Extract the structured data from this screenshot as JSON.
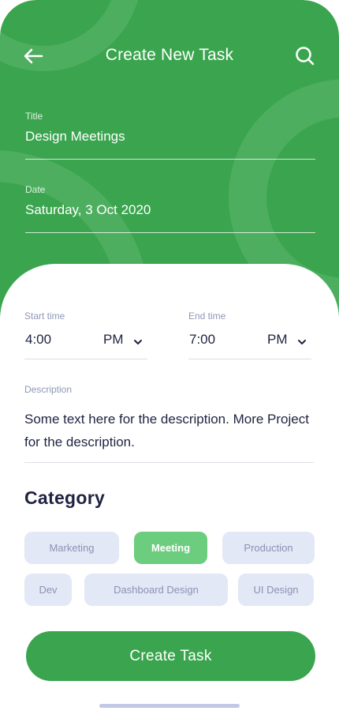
{
  "header": {
    "title": "Create New Task",
    "back_icon": "arrow-left-icon",
    "search_icon": "search-icon",
    "color": "#3aa54e"
  },
  "form": {
    "title_label": "Title",
    "title_value": "Design Meetings",
    "date_label": "Date",
    "date_value": "Saturday, 3 Oct 2020",
    "start_time": {
      "label": "Start time",
      "value": "4:00",
      "period": "PM"
    },
    "end_time": {
      "label": "End time",
      "value": "7:00",
      "period": "PM"
    },
    "description_label": "Description",
    "description_value": "Some text here for the description. More Project for the description."
  },
  "category": {
    "title": "Category",
    "chips": [
      {
        "label": "Marketing",
        "selected": false
      },
      {
        "label": "Meeting",
        "selected": true
      },
      {
        "label": "Production",
        "selected": false
      },
      {
        "label": "Dev",
        "selected": false
      },
      {
        "label": "Dashboard Design",
        "selected": false
      },
      {
        "label": "UI Design",
        "selected": false
      }
    ],
    "selected_color": "#6dcd7f",
    "chip_color": "#e3e8f6"
  },
  "actions": {
    "create_label": "Create Task"
  }
}
